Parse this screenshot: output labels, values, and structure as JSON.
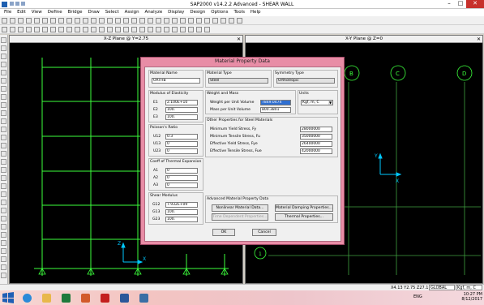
{
  "app": {
    "title": "SAP2000 v14.2.2 Advanced  -  SHEAR WALL",
    "menu": [
      "File",
      "Edit",
      "View",
      "Define",
      "Bridge",
      "Draw",
      "Select",
      "Assign",
      "Analyze",
      "Display",
      "Design",
      "Options",
      "Tools",
      "Help"
    ]
  },
  "panes": {
    "left_title": "X-Z Plane @ Y=2.75",
    "right_title": "X-Y Plane @ Z=0",
    "left_axis_z": "Z",
    "left_axis_x": "X",
    "right_axis_y": "Y",
    "right_axis_x": "X",
    "grid_bubbles": [
      "B",
      "C",
      "D"
    ],
    "grid_bubble_bottom": "1"
  },
  "status": {
    "coords": "X4.13  Y2.75  Z27.11",
    "coord_system": "GLOBAL",
    "units": "Kgf, m, C"
  },
  "taskbar": {
    "lang": "ENG",
    "time": "10:27 PM",
    "date": "8/12/2017"
  },
  "dialog": {
    "title": "Material Property Data",
    "material_name_label": "Material Name",
    "material_name": "ORTHB",
    "material_type_label": "Material Type",
    "material_type": "Steel",
    "symmetry_type_label": "Symmetry Type",
    "symmetry_type": "Orthotropic",
    "modulus_label": "Modulus of Elasticity",
    "e1_label": "E1",
    "e1": "2.100E+10",
    "e2_label": "E2",
    "e2": "100.",
    "e3_label": "E3",
    "e3": "100.",
    "poisson_label": "Poisson's Ratio",
    "u12_label": "U12",
    "u12": "0.3",
    "u13_label": "U13",
    "u13": "0",
    "u23_label": "U23",
    "u23": "0",
    "thermal_label": "Coeff of Thermal Expansion",
    "a1_label": "A1",
    "a1": "0",
    "a2_label": "A2",
    "a2": "0",
    "a3_label": "A3",
    "a3": "0",
    "shear_label": "Shear Modulus",
    "g12_label": "G12",
    "g12": "7.932E+09",
    "g13_label": "G13",
    "g13": "100.",
    "g23_label": "G23",
    "g23": "100.",
    "weight_mass_label": "Weight and Mass",
    "weight_label": "Weight per Unit Volume",
    "weight_value": "7849.0474",
    "mass_label": "Mass per Unit Volume",
    "mass_value": "800.3801",
    "units_label": "Units",
    "units_value": "Kgf, m, C",
    "other_label": "Other Properties for Steel Materials",
    "fy_label": "Minimum Yield Stress, Fy",
    "fy": "28000000",
    "fu_label": "Minimum Tensile Stress, Fu",
    "fu": "35000000",
    "fye_label": "Effective Yield Stress, Fye",
    "fye": "26400000",
    "fue_label": "Effective Tensile Stress, Fue",
    "fue": "42000000",
    "advanced_label": "Advanced Material Property Data",
    "btn_nonlinear": "Nonlinear Material Data...",
    "btn_damping": "Material Damping Properties...",
    "btn_time": "Time Dependent Properties...",
    "btn_thermal": "Thermal Properties...",
    "btn_ok": "OK",
    "btn_cancel": "Cancel"
  },
  "colors": {
    "dialog_frame": "#e88da6",
    "frame_green": "#3cff3c",
    "grid_green": "#3fa03f",
    "axis_cyan": "#00c8ff",
    "selection_blue": "#2f6fd1"
  }
}
